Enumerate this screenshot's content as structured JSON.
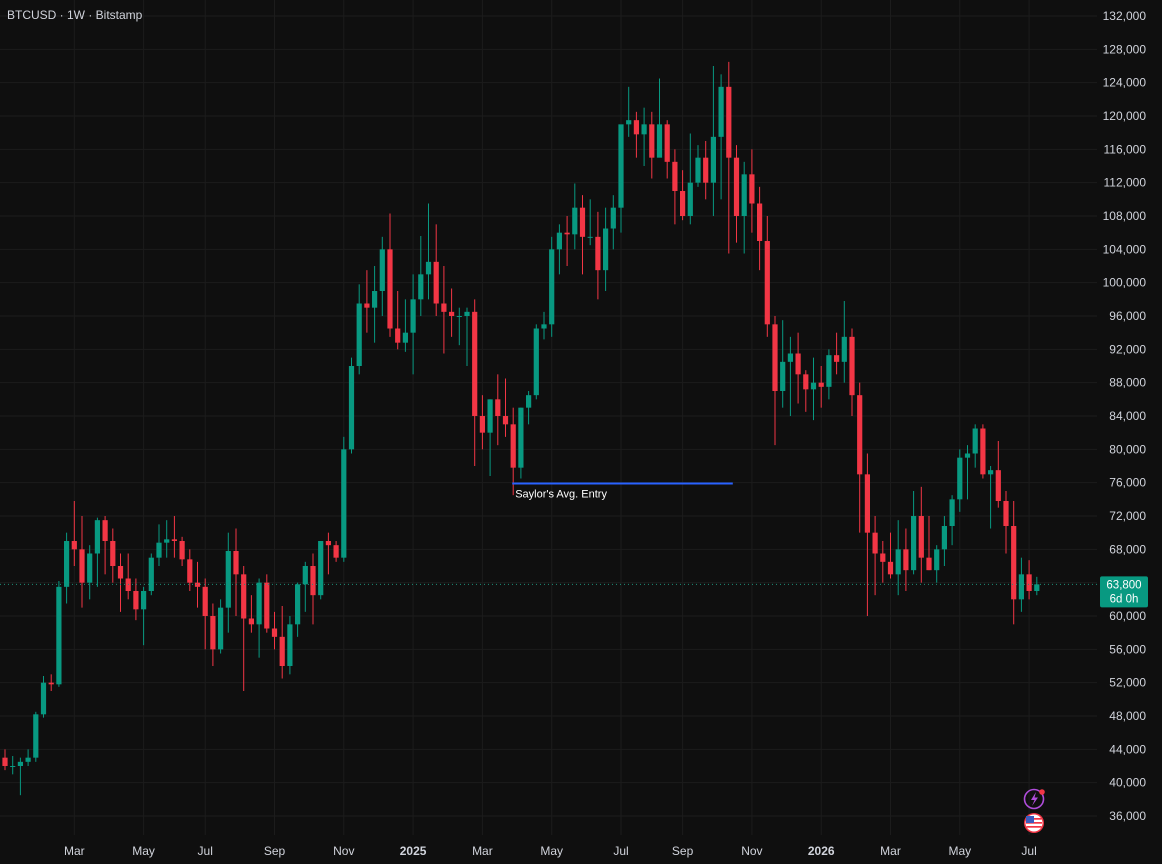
{
  "header": {
    "symbol_line": "BTCUSD · 1W · Bitstamp"
  },
  "colors": {
    "background": "#0f0f0f",
    "grid": "#1c1c1c",
    "up": "#089981",
    "down": "#f23645",
    "text": "#d1d4dc",
    "price_line": "#1f8f78",
    "annotation_line": "#2962ff",
    "badge_bg": "#089981"
  },
  "icons": {
    "lightning": "lightning-icon",
    "flag": "us-flag-icon"
  },
  "chart_data": {
    "type": "candlestick",
    "title": "",
    "ylim": [
      34000,
      133000
    ],
    "y_ticks": [
      36000,
      40000,
      44000,
      48000,
      52000,
      56000,
      60000,
      64000,
      68000,
      72000,
      76000,
      80000,
      84000,
      88000,
      92000,
      96000,
      100000,
      104000,
      108000,
      112000,
      116000,
      120000,
      124000,
      128000,
      132000
    ],
    "y_tick_labels": [
      "36,000",
      "40,000",
      "44,000",
      "48,000",
      "52,000",
      "56,000",
      "60,000",
      "64,000",
      "68,000",
      "72,000",
      "76,000",
      "80,000",
      "84,000",
      "88,000",
      "92,000",
      "96,000",
      "100,000",
      "104,000",
      "108,000",
      "112,000",
      "116,000",
      "120,000",
      "124,000",
      "128,000",
      "132,000"
    ],
    "x_ticks": [
      {
        "label": "Mar",
        "index": 9,
        "bold": false
      },
      {
        "label": "May",
        "index": 18,
        "bold": false
      },
      {
        "label": "Jul",
        "index": 26,
        "bold": false
      },
      {
        "label": "Sep",
        "index": 35,
        "bold": false
      },
      {
        "label": "Nov",
        "index": 44,
        "bold": false
      },
      {
        "label": "2025",
        "index": 53,
        "bold": true
      },
      {
        "label": "Mar",
        "index": 62,
        "bold": false
      },
      {
        "label": "May",
        "index": 71,
        "bold": false
      },
      {
        "label": "Jul",
        "index": 80,
        "bold": false
      },
      {
        "label": "Sep",
        "index": 88,
        "bold": false
      },
      {
        "label": "Nov",
        "index": 97,
        "bold": false
      },
      {
        "label": "2026",
        "index": 106,
        "bold": true
      },
      {
        "label": "Mar",
        "index": 115,
        "bold": false
      },
      {
        "label": "May",
        "index": 124,
        "bold": false
      },
      {
        "label": "Jul",
        "index": 133,
        "bold": false
      }
    ],
    "last_price": 63800,
    "last_price_label": "63,800",
    "countdown_label": "6d 0h",
    "annotation": {
      "label": "Saylor's Avg. Entry",
      "price": 75900,
      "from_index": 66,
      "to_index": 94
    },
    "candles": [
      [
        43000,
        44000,
        41500,
        42000
      ],
      [
        42000,
        43200,
        41000,
        42000
      ],
      [
        42000,
        43000,
        38500,
        42500
      ],
      [
        42500,
        44000,
        42000,
        43000
      ],
      [
        43000,
        48500,
        42500,
        48200
      ],
      [
        48200,
        52800,
        47800,
        52000
      ],
      [
        52000,
        53000,
        51000,
        51800
      ],
      [
        51800,
        64200,
        51500,
        63500
      ],
      [
        63500,
        70000,
        61500,
        69000
      ],
      [
        69000,
        73800,
        66000,
        68000
      ],
      [
        68000,
        72000,
        61000,
        64000
      ],
      [
        64000,
        68500,
        62000,
        67500
      ],
      [
        67500,
        71800,
        63500,
        71500
      ],
      [
        71500,
        72000,
        65000,
        69000
      ],
      [
        69000,
        70500,
        64000,
        66000
      ],
      [
        66000,
        67500,
        60500,
        64500
      ],
      [
        64500,
        67500,
        62000,
        63000
      ],
      [
        63000,
        64500,
        59500,
        60800
      ],
      [
        60800,
        63500,
        56500,
        63000
      ],
      [
        63000,
        67500,
        62500,
        67000
      ],
      [
        67000,
        71000,
        66000,
        68800
      ],
      [
        68800,
        71500,
        67000,
        69200
      ],
      [
        69200,
        72000,
        67000,
        69000
      ],
      [
        69000,
        69500,
        66000,
        66800
      ],
      [
        66800,
        68000,
        63000,
        64000
      ],
      [
        64000,
        66500,
        61000,
        63500
      ],
      [
        63500,
        64500,
        56000,
        60000
      ],
      [
        60000,
        61500,
        54000,
        56000
      ],
      [
        56000,
        62000,
        55500,
        61000
      ],
      [
        61000,
        70000,
        58000,
        67800
      ],
      [
        67800,
        70500,
        60000,
        65000
      ],
      [
        65000,
        66000,
        51000,
        59700
      ],
      [
        59700,
        62500,
        58000,
        59000
      ],
      [
        59000,
        64500,
        55000,
        64000
      ],
      [
        64000,
        65000,
        58000,
        58500
      ],
      [
        58500,
        60500,
        56000,
        57500
      ],
      [
        57500,
        61200,
        52500,
        54000
      ],
      [
        54000,
        60000,
        53000,
        59000
      ],
      [
        59000,
        64000,
        57500,
        63800
      ],
      [
        63800,
        66500,
        60500,
        66000
      ],
      [
        66000,
        67500,
        59000,
        62500
      ],
      [
        62500,
        66500,
        62000,
        69000
      ],
      [
        69000,
        70000,
        65000,
        68500
      ],
      [
        68500,
        69000,
        66500,
        67000
      ],
      [
        67000,
        81500,
        66500,
        80000
      ],
      [
        80000,
        91000,
        79500,
        90000
      ],
      [
        90000,
        99800,
        89000,
        97500
      ],
      [
        97500,
        101500,
        94000,
        97000
      ],
      [
        97000,
        102000,
        92800,
        99000
      ],
      [
        99000,
        105500,
        96000,
        104000
      ],
      [
        104000,
        108300,
        93500,
        94500
      ],
      [
        94500,
        99000,
        92000,
        92800
      ],
      [
        92800,
        98000,
        91700,
        94000
      ],
      [
        94000,
        101000,
        89000,
        98000
      ],
      [
        98000,
        105600,
        96000,
        101000
      ],
      [
        101000,
        109500,
        98000,
        102500
      ],
      [
        102500,
        107000,
        96000,
        97500
      ],
      [
        97500,
        102000,
        91500,
        96500
      ],
      [
        96500,
        99300,
        93500,
        96000
      ],
      [
        96000,
        97000,
        92500,
        96000
      ],
      [
        96000,
        97000,
        90000,
        96500
      ],
      [
        96500,
        98000,
        78000,
        84000
      ],
      [
        84000,
        86500,
        80000,
        82000
      ],
      [
        82000,
        86000,
        76800,
        86000
      ],
      [
        86000,
        89000,
        80500,
        84000
      ],
      [
        84000,
        88500,
        81500,
        83000
      ],
      [
        83000,
        85000,
        74500,
        77800
      ],
      [
        77800,
        85000,
        76500,
        85000
      ],
      [
        85000,
        87000,
        83000,
        86500
      ],
      [
        86500,
        95000,
        86000,
        94500
      ],
      [
        94500,
        96500,
        93200,
        95000
      ],
      [
        95000,
        105500,
        93500,
        104000
      ],
      [
        104000,
        107000,
        101000,
        106000
      ],
      [
        106000,
        108000,
        102000,
        105800
      ],
      [
        105800,
        111900,
        104000,
        109000
      ],
      [
        109000,
        110500,
        101000,
        105500
      ],
      [
        105500,
        110000,
        104500,
        105500
      ],
      [
        105500,
        108500,
        98000,
        101500
      ],
      [
        101500,
        109000,
        99000,
        106500
      ],
      [
        106500,
        110500,
        104000,
        109000
      ],
      [
        109000,
        111000,
        106000,
        119000
      ],
      [
        119000,
        123500,
        117500,
        119500
      ],
      [
        119500,
        120500,
        115000,
        117800
      ],
      [
        117800,
        121000,
        114000,
        119000
      ],
      [
        119000,
        120500,
        112500,
        115000
      ],
      [
        115000,
        124500,
        117000,
        119000
      ],
      [
        119000,
        119500,
        112500,
        114500
      ],
      [
        114500,
        116000,
        107000,
        111000
      ],
      [
        111000,
        113500,
        107500,
        108000
      ],
      [
        108000,
        117900,
        107000,
        112000
      ],
      [
        112000,
        116500,
        111500,
        115000
      ],
      [
        115000,
        117000,
        110000,
        112000
      ],
      [
        112000,
        126000,
        108000,
        117500
      ],
      [
        117500,
        125000,
        110000,
        123500
      ],
      [
        123500,
        126500,
        103500,
        115000
      ],
      [
        115000,
        116500,
        104800,
        108000
      ],
      [
        108000,
        114500,
        103500,
        113000
      ],
      [
        113000,
        116000,
        106000,
        109500
      ],
      [
        109500,
        111500,
        101500,
        105000
      ],
      [
        105000,
        108000,
        93500,
        95000
      ],
      [
        95000,
        96000,
        80500,
        87000
      ],
      [
        87000,
        95500,
        85000,
        90500
      ],
      [
        90500,
        93500,
        84000,
        91500
      ],
      [
        91500,
        94000,
        85500,
        89000
      ],
      [
        89000,
        89500,
        84500,
        87200
      ],
      [
        87200,
        91000,
        83500,
        88000
      ],
      [
        88000,
        90000,
        85000,
        87500
      ],
      [
        87500,
        92000,
        86000,
        91300
      ],
      [
        91300,
        94000,
        89000,
        90500
      ],
      [
        90500,
        97800,
        88000,
        93500
      ],
      [
        93500,
        94500,
        84000,
        86500
      ],
      [
        86500,
        88000,
        70000,
        77000
      ],
      [
        77000,
        79500,
        60000,
        70000
      ],
      [
        70000,
        72000,
        62500,
        67500
      ],
      [
        67500,
        69000,
        64000,
        66500
      ],
      [
        66500,
        70000,
        64500,
        65000
      ],
      [
        65000,
        71500,
        62500,
        68000
      ],
      [
        68000,
        70500,
        63000,
        65500
      ],
      [
        65500,
        75000,
        65000,
        72000
      ],
      [
        72000,
        75500,
        64000,
        67000
      ],
      [
        67000,
        72000,
        65500,
        65500
      ],
      [
        65500,
        68500,
        64000,
        68000
      ],
      [
        68000,
        72000,
        66000,
        70800
      ],
      [
        70800,
        74500,
        68500,
        74000
      ],
      [
        74000,
        80000,
        72500,
        79000
      ],
      [
        79000,
        80500,
        74000,
        79500
      ],
      [
        79500,
        83000,
        77800,
        82500
      ],
      [
        82500,
        83000,
        76500,
        77000
      ],
      [
        77000,
        78000,
        70500,
        77500
      ],
      [
        77500,
        81000,
        73000,
        73800
      ],
      [
        73800,
        75000,
        67500,
        70800
      ],
      [
        70800,
        73800,
        59000,
        62000
      ],
      [
        62000,
        67000,
        60500,
        65000
      ],
      [
        65000,
        66700,
        62000,
        63000
      ],
      [
        63000,
        64700,
        62500,
        63800
      ]
    ]
  }
}
